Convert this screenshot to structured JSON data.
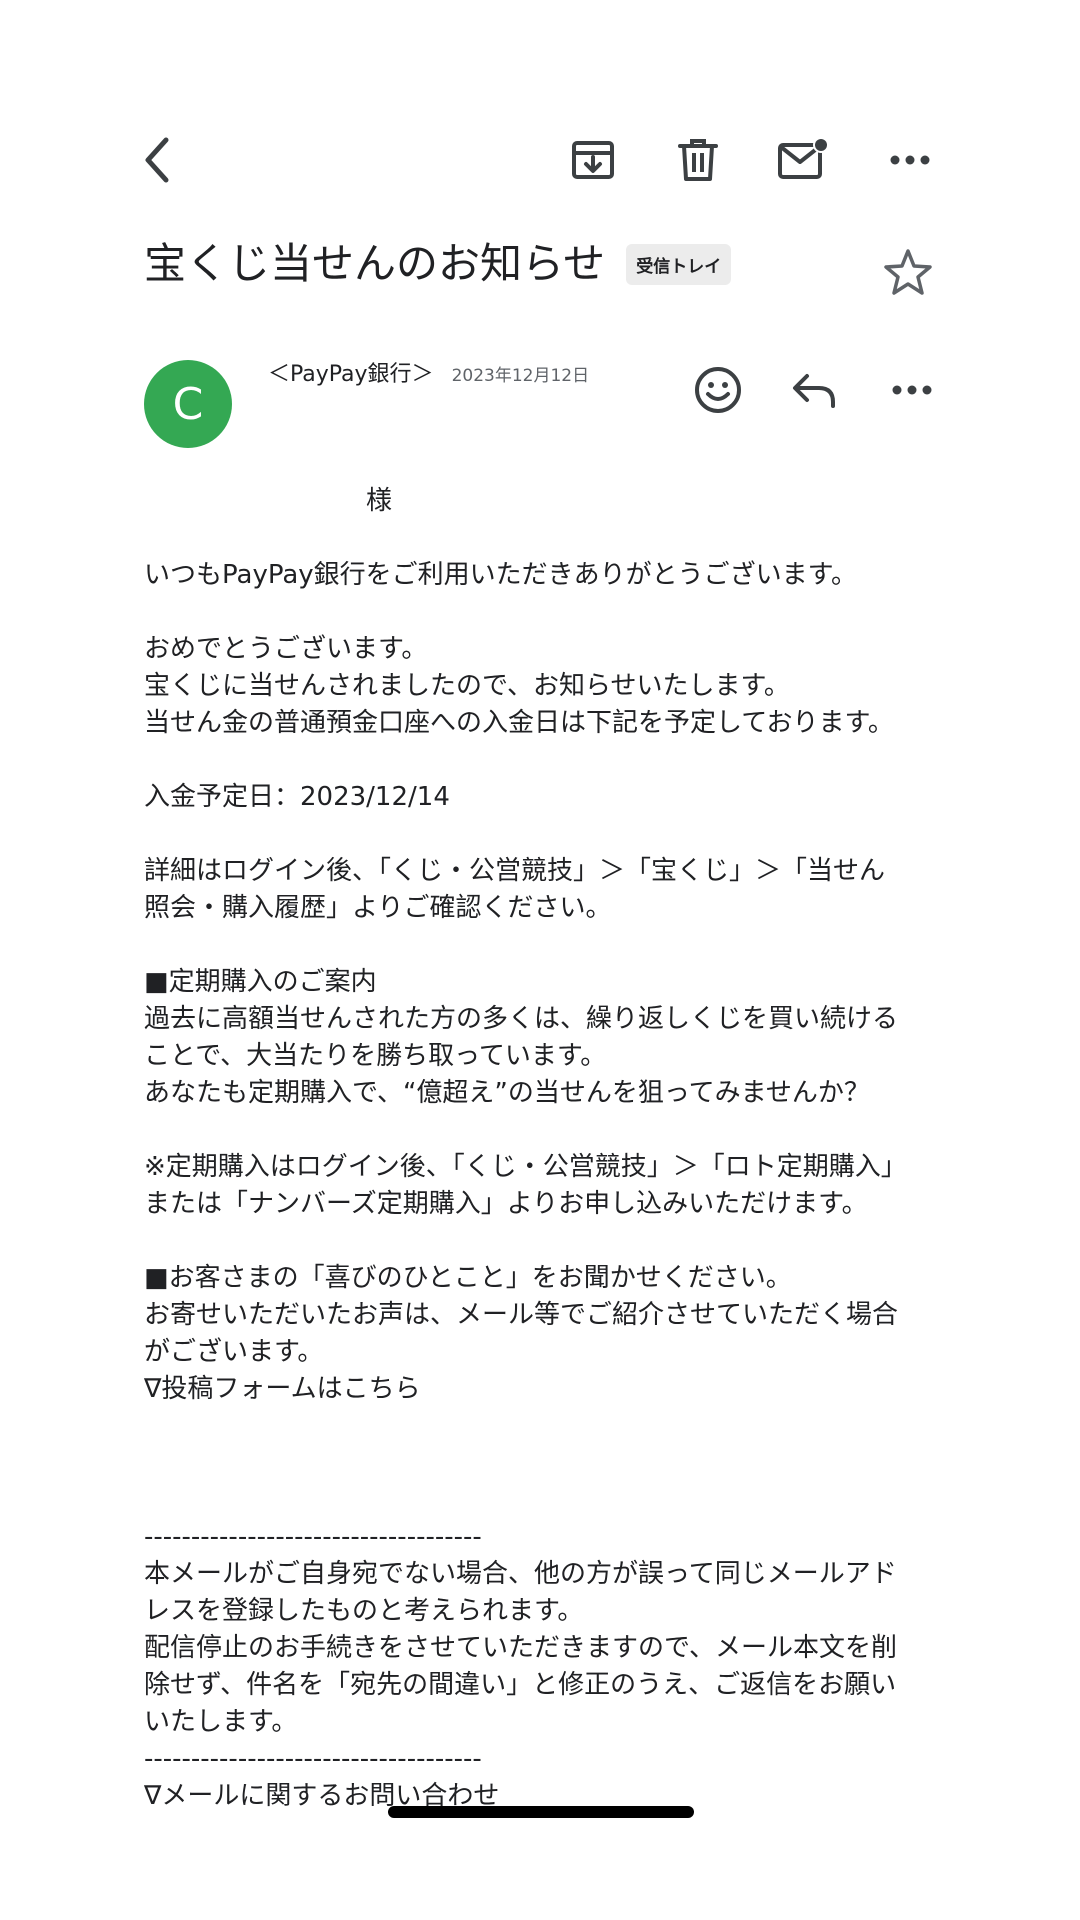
{
  "toolbar": {
    "back_icon": "chevron-left-icon",
    "archive_icon": "archive-icon",
    "delete_icon": "trash-icon",
    "mark_unread_icon": "mail-unread-icon",
    "more_icon": "more-horizontal-icon"
  },
  "message": {
    "subject": "宝くじ当せんのお知らせ",
    "label": "受信トレイ",
    "avatar_letter": "C",
    "avatar_color": "#34a853",
    "sender": "＜PayPay銀行＞",
    "date": "2023年12月12日"
  },
  "body": {
    "lines": [
      "様",
      "",
      "いつもPayPay銀行をご利用いただきありがとうございます。",
      "",
      "おめでとうございます。",
      "宝くじに当せんされましたので、お知らせいたします。",
      "当せん金の普通預金口座への入金日は下記を予定しております。",
      "",
      "入金予定日：2023/12/14",
      "",
      "詳細はログイン後、「くじ・公営競技」＞「宝くじ」＞「当せん",
      "照会・購入履歴」よりご確認ください。",
      "",
      "■定期購入のご案内",
      "過去に高額当せんされた方の多くは、繰り返しくじを買い続ける",
      "ことで、大当たりを勝ち取っています。",
      "あなたも定期購入で、“億超え”の当せんを狙ってみませんか？",
      "",
      "※定期購入はログイン後、「くじ・公営競技」＞「ロト定期購入」",
      "または「ナンバーズ定期購入」よりお申し込みいただけます。",
      "",
      "■お客さまの「喜びのひとこと」をお聞かせください。",
      "お寄せいただいたお声は、メール等でご紹介させていただく場合",
      "がございます。",
      "∇投稿フォームはこちら",
      "",
      "",
      "",
      "------------------------------------",
      "本メールがご自身宛でない場合、他の方が誤って同じメールアド",
      "レスを登録したものと考えられます。",
      "配信停止のお手続きをさせていただきますので、メール本文を削",
      "除せず、件名を「宛先の間違い」と修正のうえ、ご返信をお願い",
      "いたします。",
      "------------------------------------",
      "∇メールに関するお問い合わせ"
    ]
  },
  "colors": {
    "link": "#1a73e8",
    "text": "#202124",
    "secondary": "#5f6368"
  }
}
